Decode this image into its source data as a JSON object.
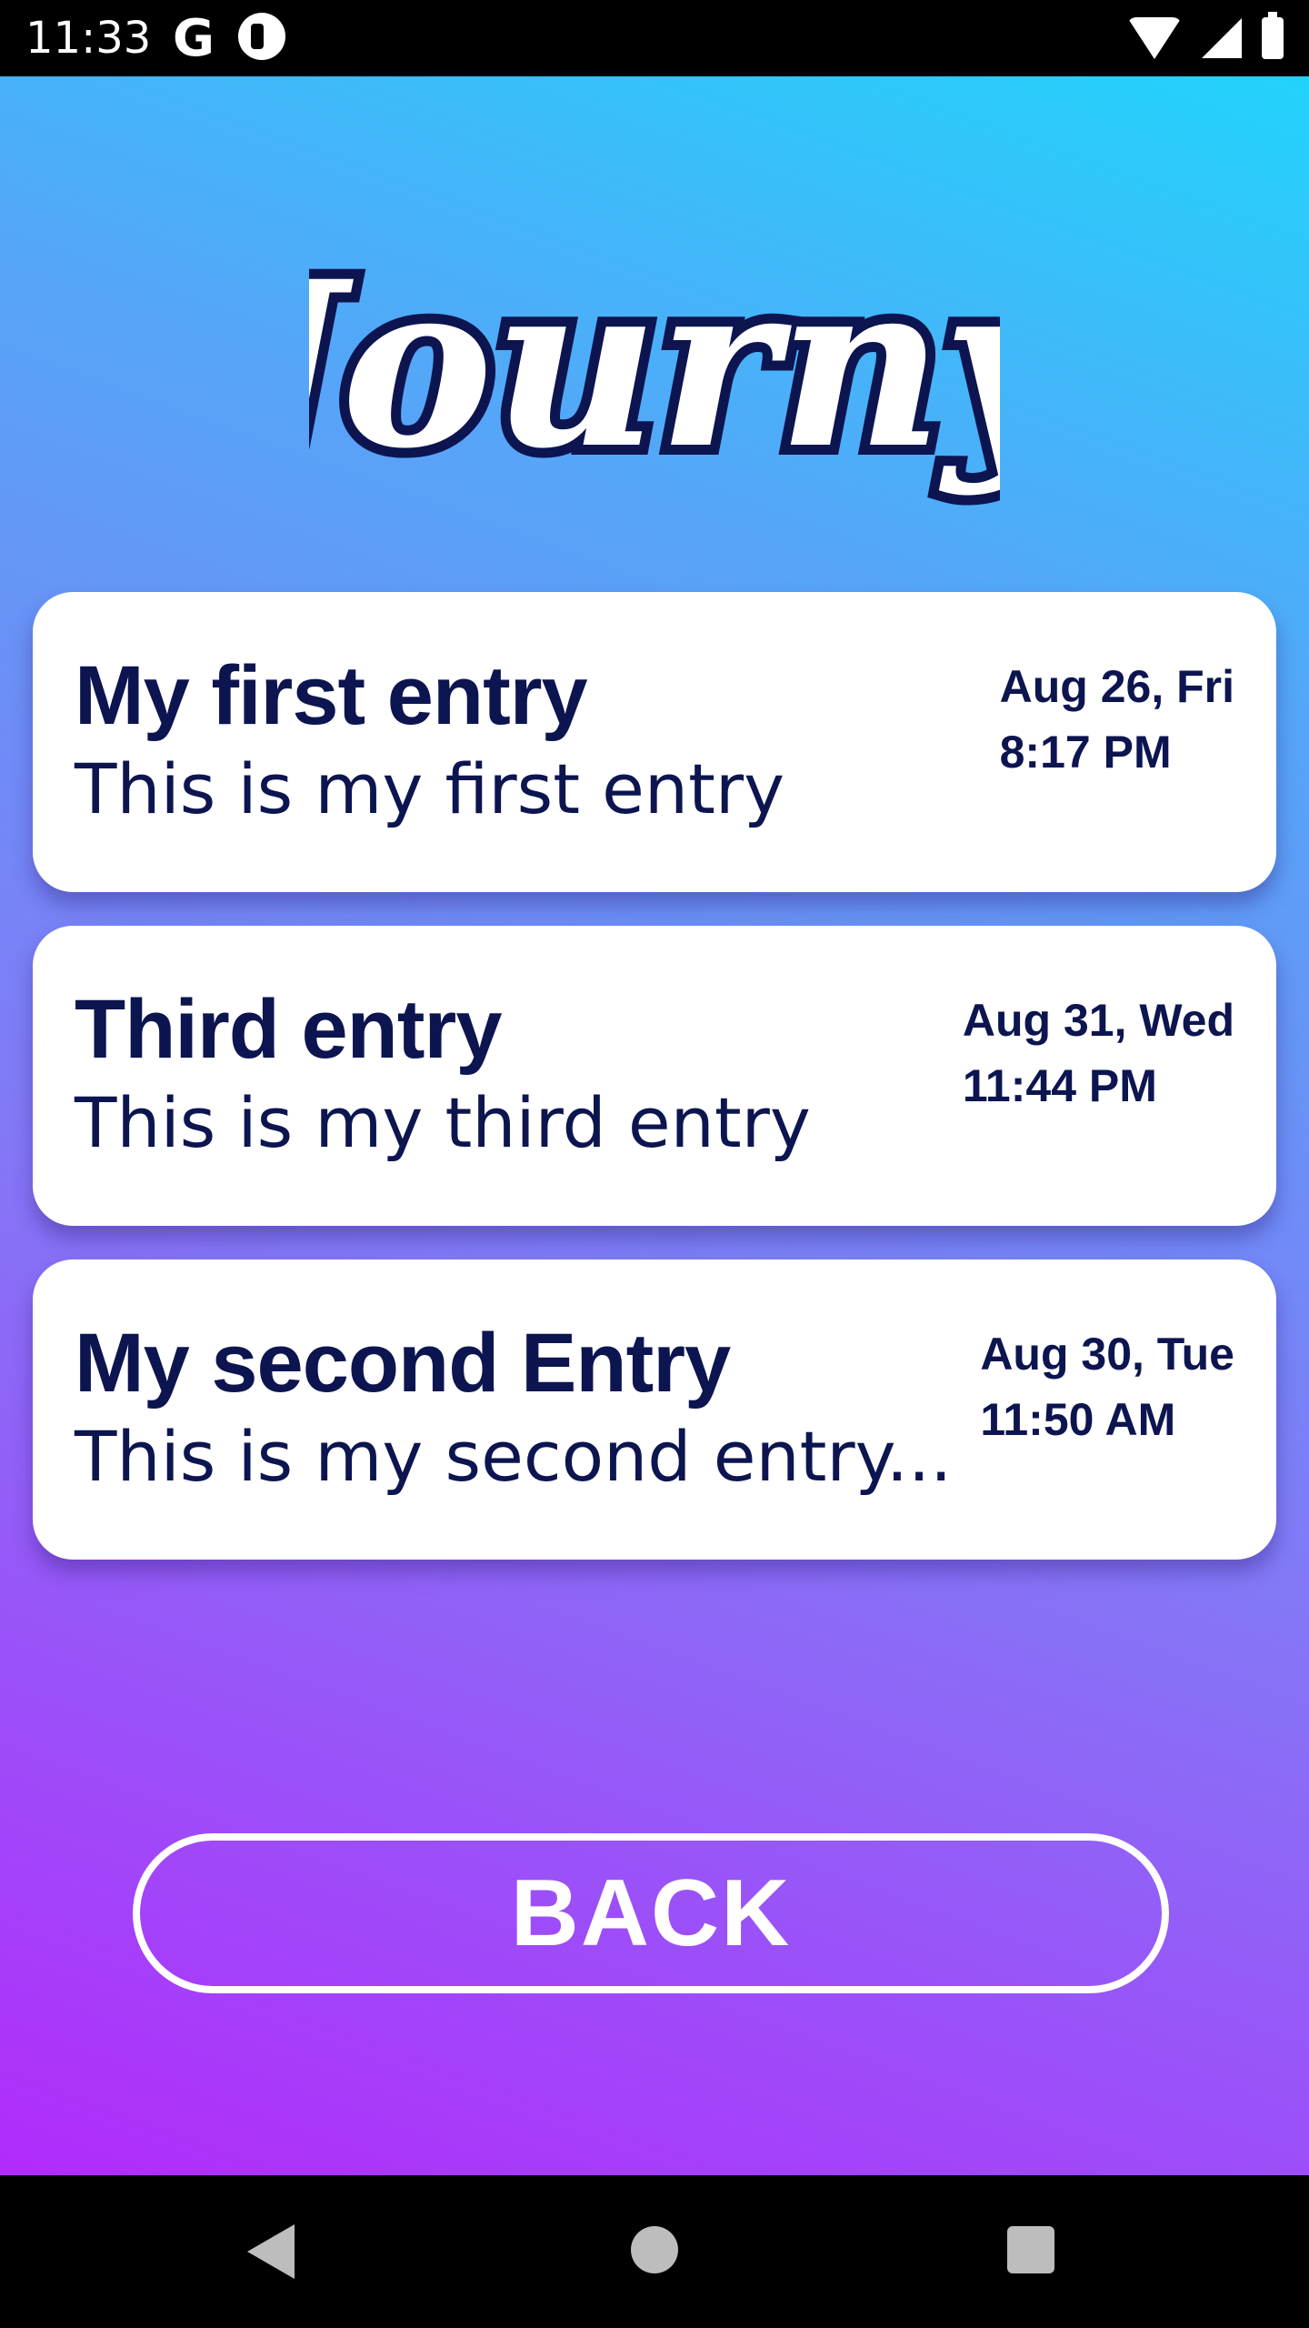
{
  "status_bar": {
    "time": "11:33",
    "g_icon_label": "G",
    "icons": [
      "google-icon",
      "app-notification-icon",
      "wifi-icon",
      "signal-icon",
      "battery-icon"
    ]
  },
  "app": {
    "logo_text": "Journy",
    "colors": {
      "text": "#0c1550",
      "gradient_top": "#22d3fb",
      "gradient_bottom": "#b12bfb"
    }
  },
  "entries": [
    {
      "title": "My first entry",
      "body": "This is my first entry",
      "date": "Aug 26, Fri",
      "time": "8:17 PM"
    },
    {
      "title": "Third entry",
      "body": "This is my third entry",
      "date": "Aug 31, Wed",
      "time": "11:44 PM"
    },
    {
      "title": "My second Entry",
      "body": "This is my second entry...",
      "date": "Aug 30, Tue",
      "time": "11:50 AM"
    }
  ],
  "back_button": {
    "label": "BACK"
  },
  "nav_bar": {
    "icons": [
      "back-triangle-icon",
      "home-circle-icon",
      "recents-square-icon"
    ]
  }
}
